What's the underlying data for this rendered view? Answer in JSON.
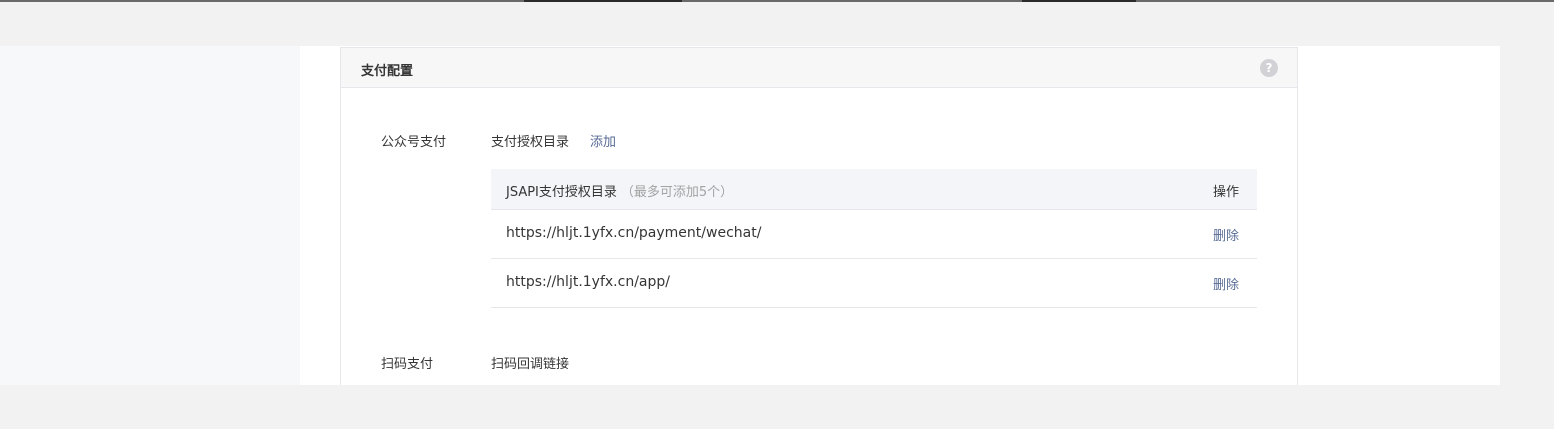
{
  "card": {
    "title": "支付配置",
    "help_icon_glyph": "?"
  },
  "jsapi_section": {
    "label": "公众号支付",
    "field_label": "支付授权目录",
    "add_link": "添加",
    "table": {
      "header_title": "JSAPI支付授权目录",
      "header_note": "（最多可添加5个）",
      "header_action": "操作",
      "rows": [
        {
          "url": "https://hljt.1yfx.cn/payment/wechat/",
          "action": "删除"
        },
        {
          "url": "https://hljt.1yfx.cn/app/",
          "action": "删除"
        }
      ]
    }
  },
  "scan_section": {
    "label": "扫码支付",
    "field_label": "扫码回调链接"
  },
  "colors": {
    "link": "#576b95",
    "muted": "#a3a3a3",
    "text": "#353535"
  }
}
